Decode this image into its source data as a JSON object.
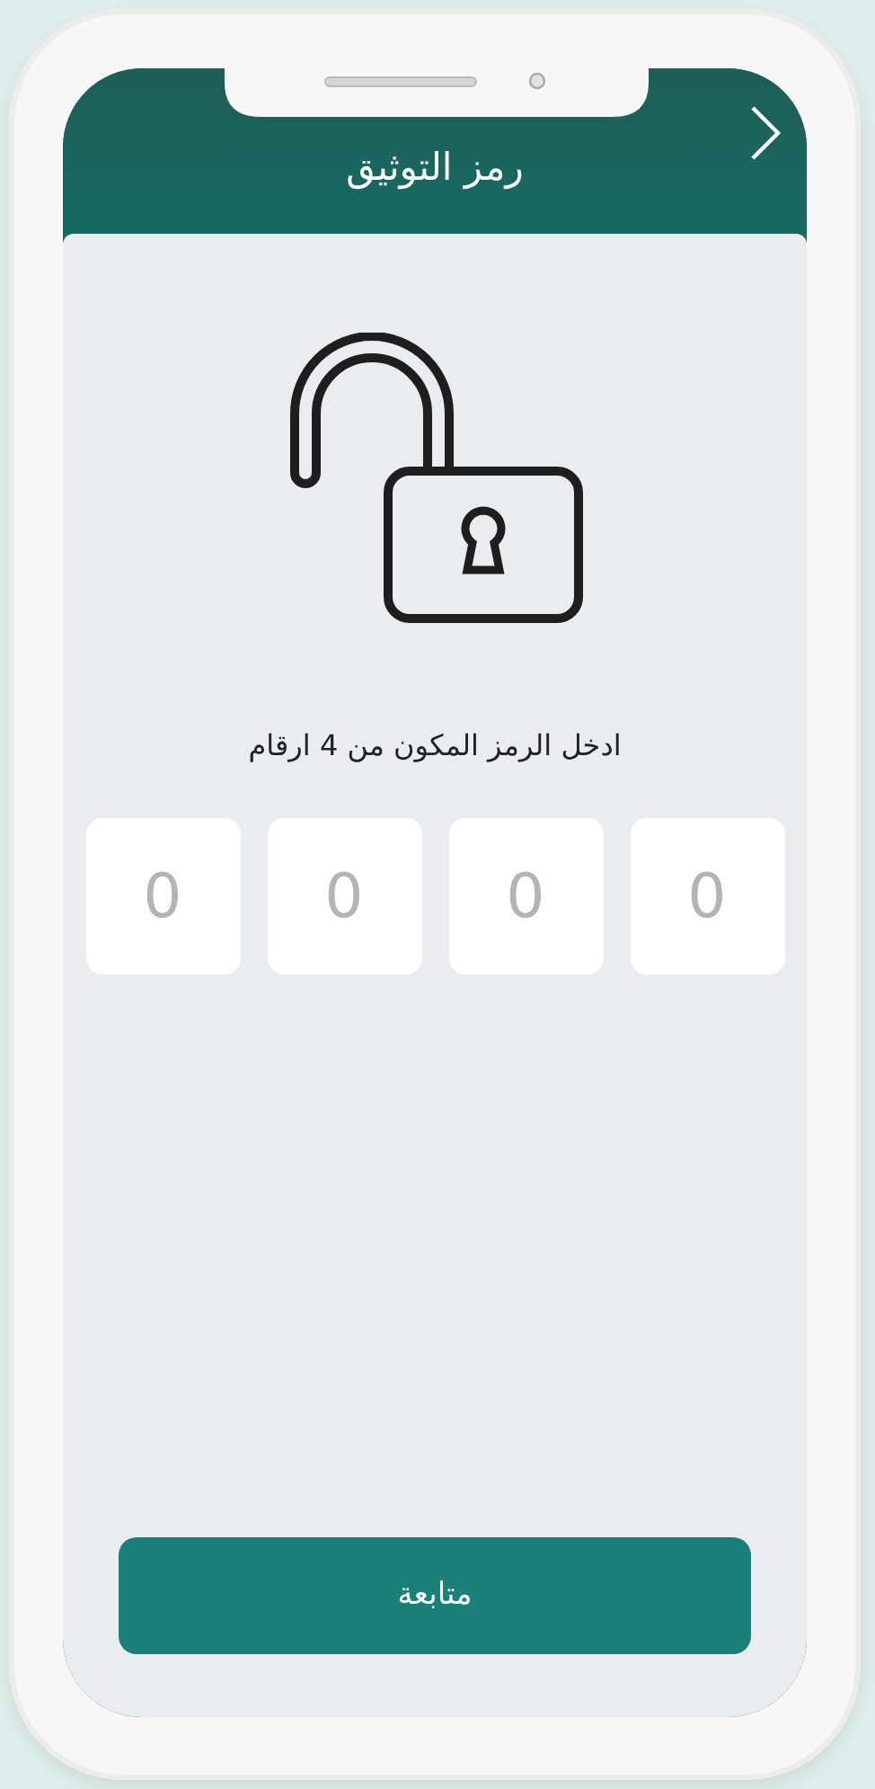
{
  "header": {
    "title": "رمز التوثيق"
  },
  "instruction": "ادخل الرمز المكون من 4 ارقام",
  "code_inputs": [
    {
      "placeholder": "0"
    },
    {
      "placeholder": "0"
    },
    {
      "placeholder": "0"
    },
    {
      "placeholder": "0"
    }
  ],
  "continue_button": "متابعة"
}
